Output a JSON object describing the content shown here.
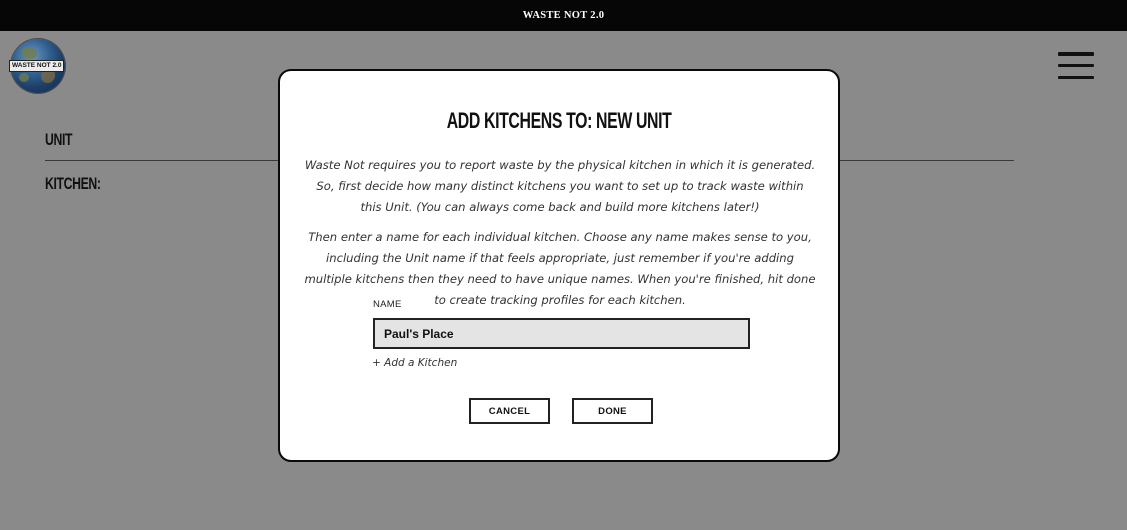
{
  "app": {
    "title": "WASTE NOT 2.0",
    "logo_text": "WASTE NOT 2.0"
  },
  "background": {
    "unit_label": "UNIT",
    "kitchen_label": "KITCHEN:"
  },
  "modal": {
    "title": "ADD KITCHENS TO: NEW UNIT",
    "paragraph_1": "Waste Not requires you to report waste by the physical kitchen in which it is generated. So, first decide how many distinct kitchens you want to set up to track waste within this Unit. (You can always come back and build more kitchens later!)",
    "paragraph_2": "Then enter a name for each individual kitchen. Choose any name makes sense to you, including the Unit name if that feels appropriate, just remember if you're adding multiple kitchens then they need to have unique names. When you're finished, hit done to create tracking profiles for each kitchen.",
    "name_label": "NAME",
    "name_value": "Paul's Place",
    "add_kitchen_label": "+ Add a Kitchen",
    "cancel_label": "CANCEL",
    "done_label": "DONE"
  },
  "icons": {
    "logo": "globe-logo-icon",
    "menu": "hamburger-menu-icon"
  },
  "colors": {
    "topbar": "#060606",
    "overlay": "#8a8a8a",
    "modal": "#ffffff",
    "input_bg": "#e4e4e4"
  }
}
